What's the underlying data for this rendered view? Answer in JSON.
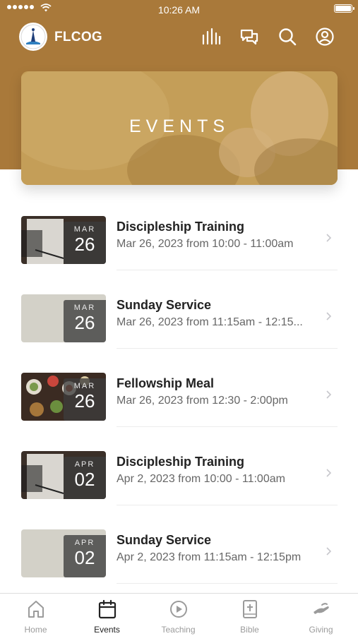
{
  "status_bar": {
    "time": "10:26 AM"
  },
  "app": {
    "name": "FLCOG"
  },
  "top_icons": [
    "equalizer-icon",
    "chat-icon",
    "search-icon",
    "user-icon"
  ],
  "banner": {
    "title": "EVENTS"
  },
  "events": [
    {
      "month": "MAR",
      "day": "26",
      "title": "Discipleship Training",
      "time": "Mar 26, 2023 from 10:00 - 11:00am",
      "thumb": "notebook"
    },
    {
      "month": "MAR",
      "day": "26",
      "title": "Sunday Service",
      "time": "Mar 26, 2023 from 11:15am - 12:15...",
      "thumb": "plain"
    },
    {
      "month": "MAR",
      "day": "26",
      "title": "Fellowship Meal",
      "time": "Mar 26, 2023 from 12:30 - 2:00pm",
      "thumb": "food"
    },
    {
      "month": "APR",
      "day": "02",
      "title": "Discipleship Training",
      "time": "Apr 2, 2023 from 10:00 - 11:00am",
      "thumb": "notebook"
    },
    {
      "month": "APR",
      "day": "02",
      "title": "Sunday Service",
      "time": "Apr 2, 2023 from 11:15am - 12:15pm",
      "thumb": "plain"
    }
  ],
  "tabs": [
    {
      "label": "Home",
      "icon": "home-icon",
      "active": false
    },
    {
      "label": "Events",
      "icon": "calendar-icon",
      "active": true
    },
    {
      "label": "Teaching",
      "icon": "play-icon",
      "active": false
    },
    {
      "label": "Bible",
      "icon": "bible-icon",
      "active": false
    },
    {
      "label": "Giving",
      "icon": "giving-hand-icon",
      "active": false
    }
  ],
  "colors": {
    "header": "#a9793a",
    "banner": "#c9a661",
    "tab_active": "#222222",
    "tab_inactive": "#9b9b9b"
  }
}
